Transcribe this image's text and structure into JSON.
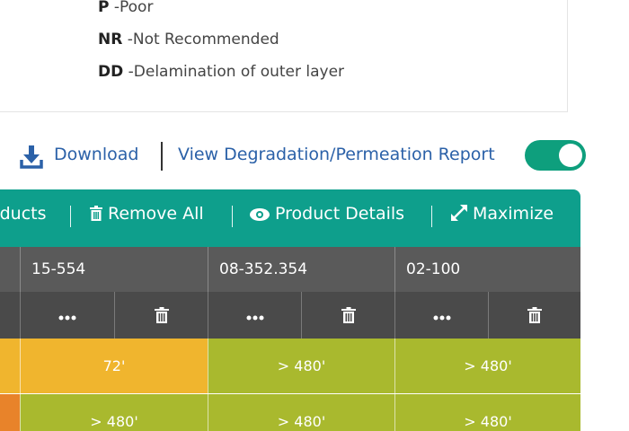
{
  "legend": {
    "items": [
      {
        "code": "P",
        "desc": "Poor"
      },
      {
        "code": "NR",
        "desc": "Not Recommended"
      },
      {
        "code": "DD",
        "desc": "Delamination of outer layer"
      }
    ]
  },
  "actions": {
    "download_label": "Download",
    "report_label": "View Degradation/Permeation Report",
    "report_toggle_on": true
  },
  "toolbar": {
    "products_label": "oducts",
    "remove_all_label": "Remove All",
    "product_details_label": "Product Details",
    "maximize_label": "Maximize"
  },
  "table": {
    "columns": [
      "15-554",
      "08-352.354",
      "02-100"
    ],
    "rows": [
      {
        "cells": [
          "72'",
          "> 480'",
          "> 480'"
        ],
        "colors": [
          "#f0b52e",
          "#a9b92e",
          "#a9b92e"
        ],
        "leftColor": "#f0b52e"
      },
      {
        "cells": [
          "> 480'",
          "> 480'",
          "> 480'"
        ],
        "colors": [
          "#a9b92e",
          "#a9b92e",
          "#a9b92e"
        ],
        "leftColor": "#e8832a"
      }
    ]
  },
  "colors": {
    "toolbar": "#0e9f8c",
    "link": "#2b61a8",
    "header": "#5a5a5a"
  }
}
